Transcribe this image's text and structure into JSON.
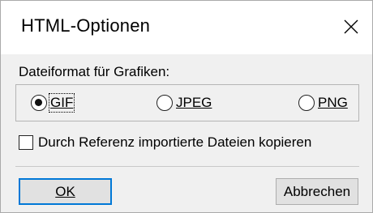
{
  "window": {
    "title": "HTML-Optionen",
    "close_icon": "close-icon"
  },
  "graphics_format": {
    "label": "Dateiformat für Grafiken:",
    "options": [
      {
        "label": "GIF",
        "selected": true
      },
      {
        "label": "JPEG",
        "selected": false
      },
      {
        "label": "PNG",
        "selected": false
      }
    ]
  },
  "copy_referenced_files": {
    "label": "Durch Referenz importierte Dateien kopieren",
    "checked": false
  },
  "buttons": {
    "ok": "OK",
    "cancel": "Abbrechen"
  },
  "colors": {
    "accent": "#0078d7",
    "titlebar": "#ffffff",
    "background": "#f0f0f0"
  }
}
